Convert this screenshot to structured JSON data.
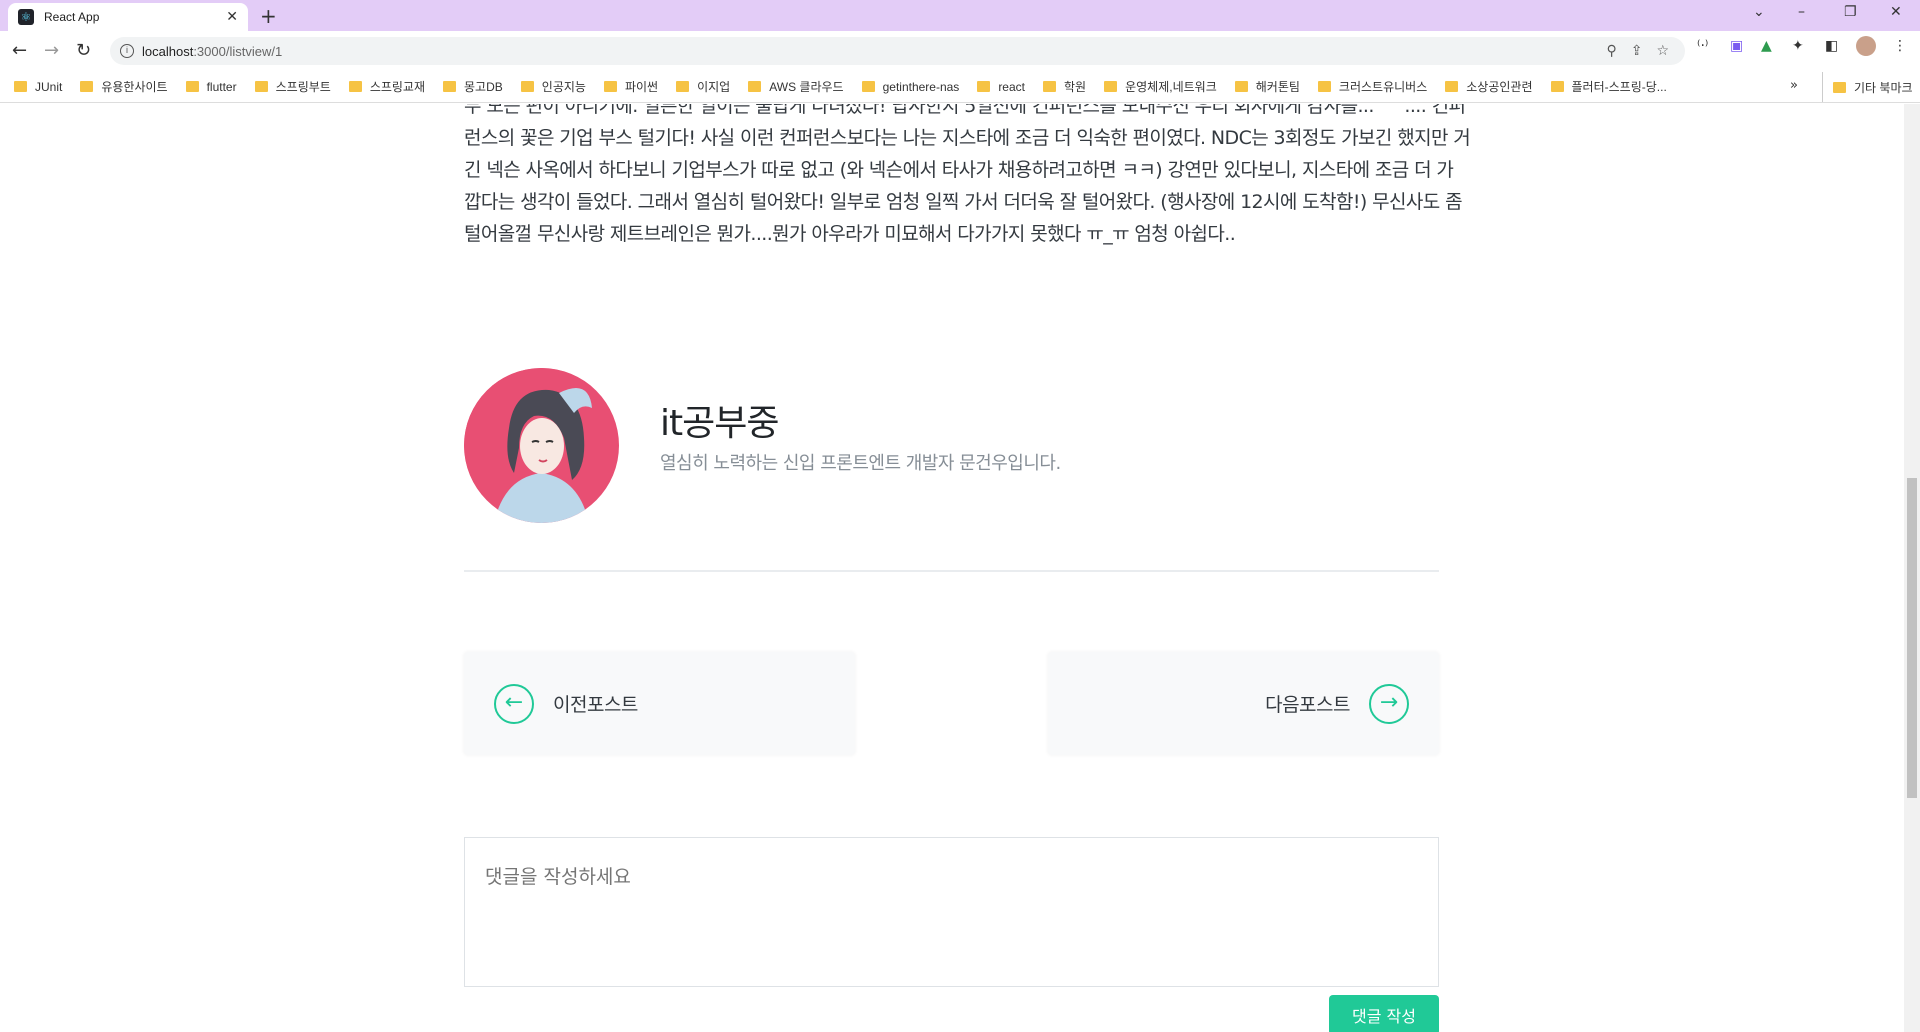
{
  "browser": {
    "tab_title": "React App",
    "url_host": "localhost",
    "url_rest": ":3000/listview/1"
  },
  "bookmarks": [
    "JUnit",
    "유용한사이트",
    "flutter",
    "스프링부트",
    "스프링교재",
    "몽고DB",
    "인공지능",
    "파이썬",
    "이지업",
    "AWS 클라우드",
    "getinthere-nas",
    "react",
    "학원",
    "운영체제,네트워크",
    "해커톤팀",
    "크러스트유니버스",
    "소상공인관련",
    "플러터-스프링-당..."
  ],
  "bookmarks_other": "기타 북마크",
  "post": {
    "paragraph_lines": [
      "두 모든 편이 아니기에. 일른한 일이는 물답게 다녀졌다! 답사한지 5일전에 컨퍼런스를 모내주신 우리 회사에게 감사를...^^.... 컨퍼",
      "런스의 꽃은 기업 부스 털기다! 사실 이런 컨퍼런스보다는 나는 지스타에 조금 더 익숙한 편이였다. NDC는 3회정도 가보긴 했지만 거",
      "긴 넥슨 사옥에서 하다보니 기업부스가 따로 없고 (와 넥슨에서 타사가 채용하려고하면 ㅋㅋ) 강연만 있다보니, 지스타에 조금 더 가",
      "깝다는 생각이 들었다. 그래서 열심히 털어왔다! 일부로 엄청 일찍 가서 더더욱 잘 털어왔다. (행사장에 12시에 도착함!) 무신사도 좀",
      "털어올껄 무신사랑 제트브레인은 뭔가....뭔가 아우라가 미묘해서 다가가지 못했다 ㅠ_ㅠ 엄청 아쉽다.."
    ]
  },
  "profile": {
    "name": "it공부중",
    "description": "열심히 노력하는 신입 프론트엔트 개발자 문건우입니다."
  },
  "post_nav": {
    "prev_label": "이전포스트",
    "next_label": "다음포스트"
  },
  "comment": {
    "placeholder": "댓글을 작성하세요",
    "submit_label": "댓글 작성"
  },
  "colors": {
    "accent": "#20c997",
    "tabbar": "#e3ccf7",
    "avatar_bg": "#e84f73"
  }
}
